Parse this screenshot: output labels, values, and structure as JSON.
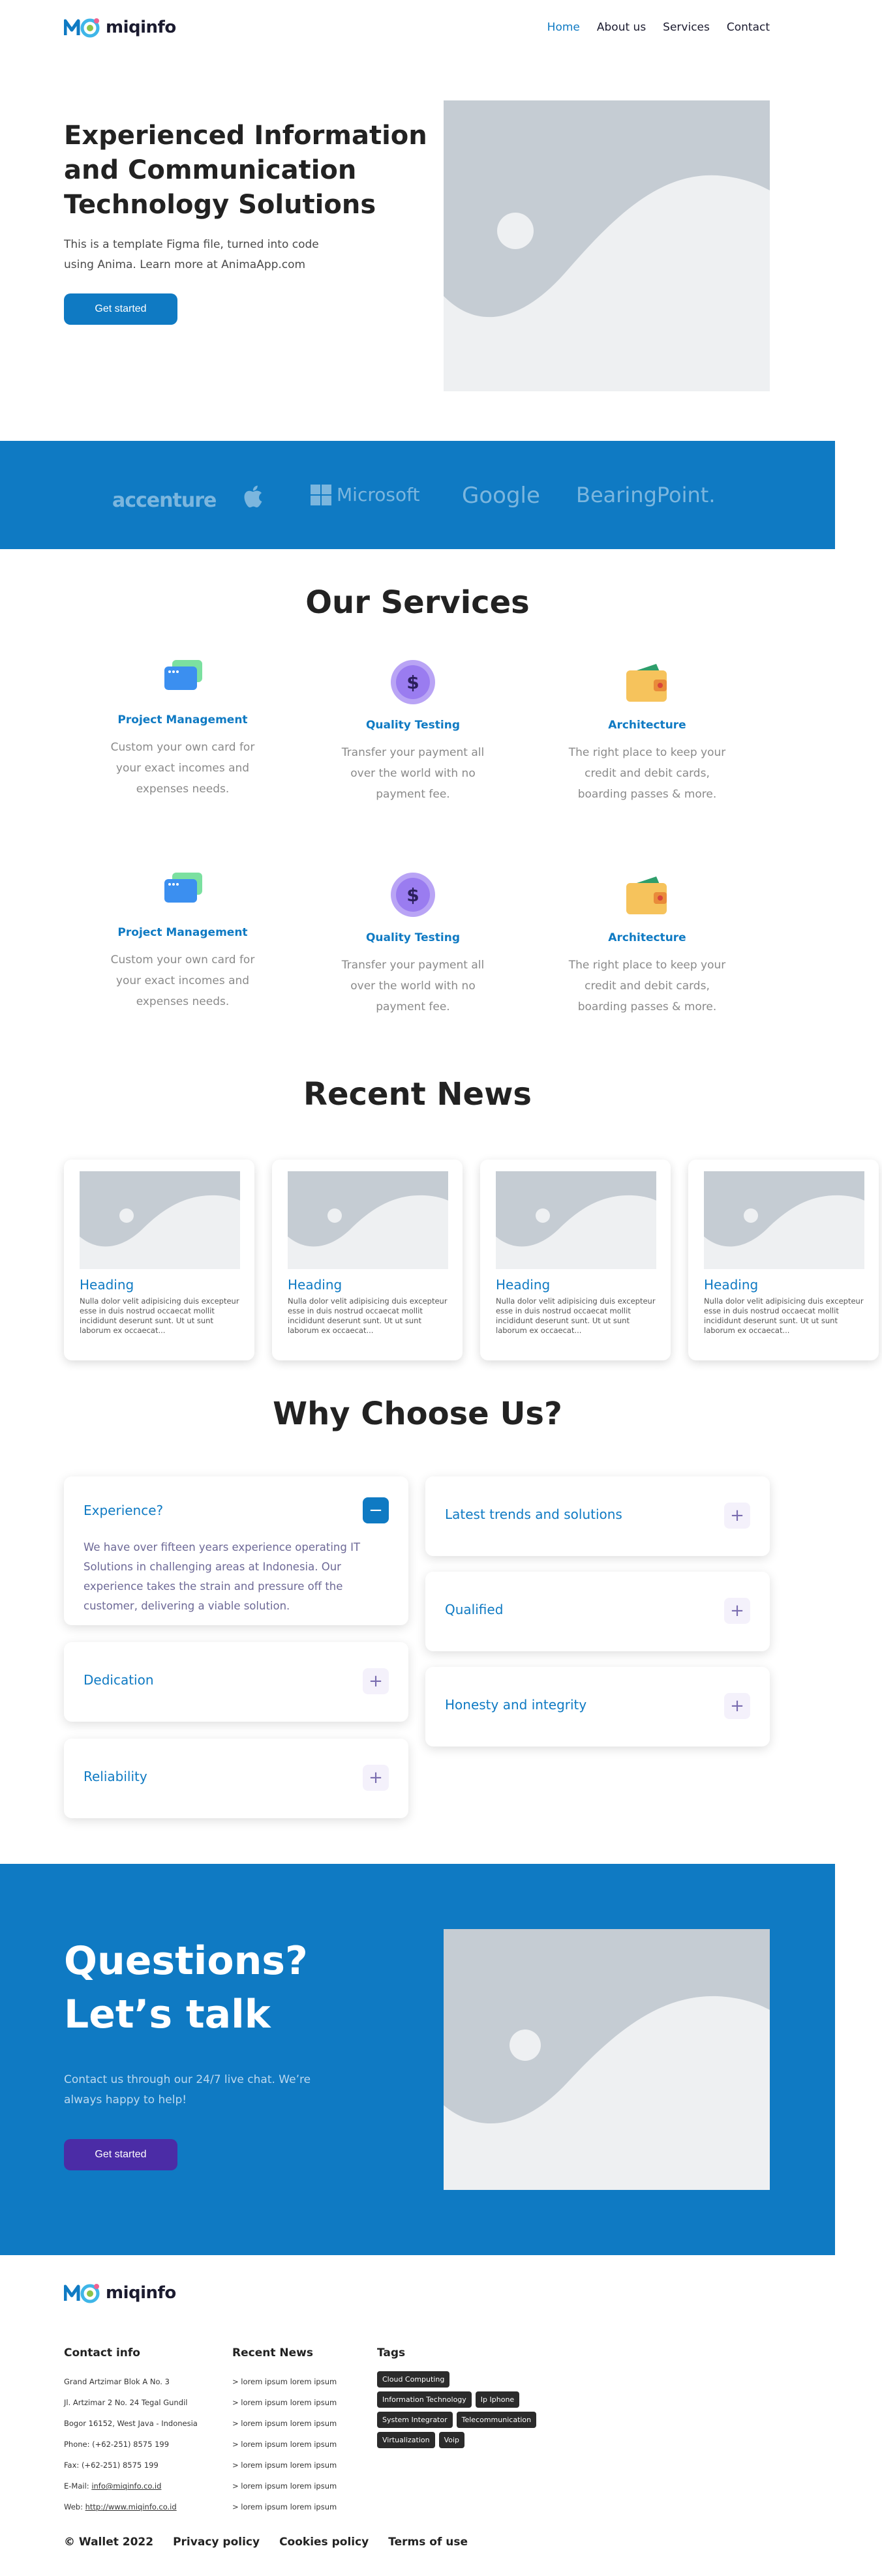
{
  "brand": {
    "name": "miqinfo",
    "accent": "#0f7ac3",
    "cta_button_color": "#4b2ca6"
  },
  "nav": {
    "items": [
      {
        "label": "Home",
        "active": true
      },
      {
        "label": "About us",
        "active": false
      },
      {
        "label": "Services",
        "active": false
      },
      {
        "label": "Contact",
        "active": false
      }
    ]
  },
  "hero": {
    "title": "Experienced Information and Communication Technology Solutions",
    "description": "This is a template Figma file, turned into code using Anima. Learn more at AnimaApp.com",
    "button": "Get started",
    "image_icon": "image-placeholder-icon"
  },
  "partners": [
    "accenture",
    "apple-logo-icon",
    "Microsoft",
    "Google",
    "BearingPoint."
  ],
  "services": {
    "title": "Our Services",
    "items": [
      {
        "name": "Project Management",
        "description": "Custom your own card for your exact incomes and expenses needs.",
        "icon": "cards-icon"
      },
      {
        "name": "Quality Testing",
        "description": "Transfer your payment all over the world with no payment fee.",
        "icon": "dollar-coin-icon"
      },
      {
        "name": "Architecture",
        "description": "The right place to keep your credit and debit cards, boarding passes & more.",
        "icon": "wallet-icon"
      },
      {
        "name": "Project Management",
        "description": "Custom your own card for your exact incomes and expenses needs.",
        "icon": "cards-icon"
      },
      {
        "name": "Quality Testing",
        "description": "Transfer your payment all over the world with no payment fee.",
        "icon": "dollar-coin-icon"
      },
      {
        "name": "Architecture",
        "description": "The right place to keep your credit and debit cards, boarding passes & more.",
        "icon": "wallet-icon"
      }
    ]
  },
  "news": {
    "title": "Recent News",
    "items": [
      {
        "heading": "Heading",
        "body": "Nulla dolor velit adipisicing duis excepteur esse in duis nostrud occaecat mollit incididunt deserunt sunt. Ut ut sunt laborum ex occaecat..."
      },
      {
        "heading": "Heading",
        "body": "Nulla dolor velit adipisicing duis excepteur esse in duis nostrud occaecat mollit incididunt deserunt sunt. Ut ut sunt laborum ex occaecat..."
      },
      {
        "heading": "Heading",
        "body": "Nulla dolor velit adipisicing duis excepteur esse in duis nostrud occaecat mollit incididunt deserunt sunt. Ut ut sunt laborum ex occaecat..."
      },
      {
        "heading": "Heading",
        "body": "Nulla dolor velit adipisicing duis excepteur esse in duis nostrud occaecat mollit incididunt deserunt sunt. Ut ut sunt laborum ex occaecat..."
      }
    ]
  },
  "why": {
    "title": "Why Choose Us?",
    "items": [
      {
        "title": "Experience?",
        "expanded": true,
        "toggle": "−",
        "body": "We have over fifteen years experience operating IT Solutions in challenging areas at Indonesia. Our experience takes the strain and pressure off the customer, delivering a viable solution."
      },
      {
        "title": "Dedication",
        "expanded": false,
        "toggle": "+"
      },
      {
        "title": "Reliability",
        "expanded": false,
        "toggle": "+"
      },
      {
        "title": "Latest trends and solutions",
        "expanded": false,
        "toggle": "+"
      },
      {
        "title": "Qualified",
        "expanded": false,
        "toggle": "+"
      },
      {
        "title": "Honesty and integrity",
        "expanded": false,
        "toggle": "+"
      }
    ]
  },
  "cta": {
    "title_line1": "Questions?",
    "title_line2": "Let’s talk",
    "description": "Contact us through our 24/7 live chat. We’re always happy to help!",
    "button": "Get started"
  },
  "footer": {
    "contact": {
      "title": "Contact info",
      "lines": [
        "Grand Artzimar Blok A No. 3",
        "Jl. Artzimar 2 No. 24 Tegal Gundil",
        "Bogor 16152, West Java - Indonesia",
        "Phone: (+62-251) 8575 199",
        "Fax: (+62-251) 8575 199"
      ],
      "email_label": "E-Mail: ",
      "email": "info@miqinfo.co.id",
      "web_label": "Web: ",
      "web": "http://www.miqinfo.co.id"
    },
    "news": {
      "title": "Recent News",
      "items": [
        "> lorem ipsum lorem ipsum",
        "> lorem ipsum lorem ipsum",
        "> lorem ipsum lorem ipsum",
        "> lorem ipsum lorem ipsum",
        "> lorem ipsum lorem ipsum",
        "> lorem ipsum lorem ipsum",
        "> lorem ipsum lorem ipsum"
      ]
    },
    "tags": {
      "title": "Tags",
      "items": [
        "Cloud Computing",
        "Information Technology",
        "Ip Iphone",
        "System Integrator",
        "Telecommunication",
        "Virtualization",
        "Voip"
      ]
    },
    "bottom": {
      "copyright": "©  Wallet 2022",
      "privacy": "Privacy policy",
      "cookies": "Cookies policy",
      "terms": "Terms of use"
    }
  }
}
